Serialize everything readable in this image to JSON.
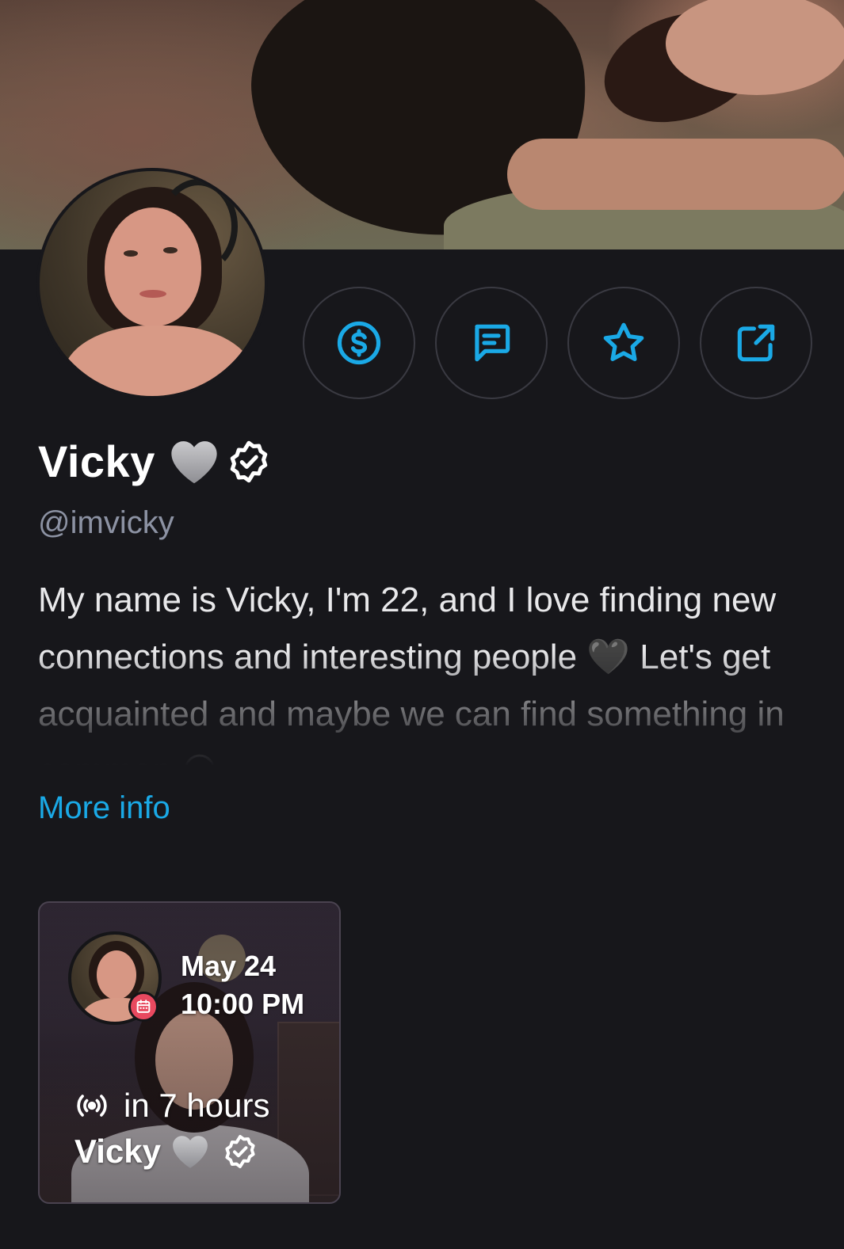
{
  "profile": {
    "name": "Vicky",
    "handle": "@imvicky",
    "bio": "My name is Vicky, I'm 22, and I love finding new connections and interesting people 🖤 Let's get acquainted and maybe we can find something in common 😏",
    "more_info_label": "More info",
    "accent_color": "#1aa9e6"
  },
  "actions": [
    {
      "icon": "dollar-icon"
    },
    {
      "icon": "message-icon"
    },
    {
      "icon": "star-icon"
    },
    {
      "icon": "share-icon"
    }
  ],
  "stream_card": {
    "date": "May 24",
    "time": "10:00 PM",
    "countdown": "in 7 hours",
    "streamer_name": "Vicky",
    "badge_icon": "calendar-icon",
    "badge_color": "#e8495f",
    "live_icon": "broadcast-icon"
  }
}
